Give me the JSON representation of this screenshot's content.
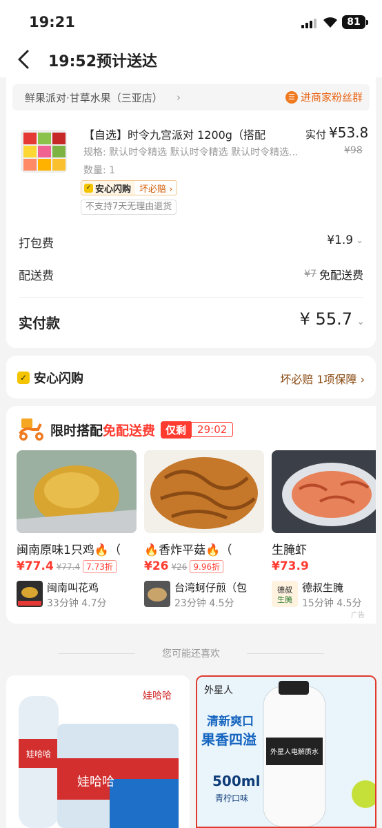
{
  "status_bar": {
    "time": "19:21",
    "battery": "81"
  },
  "nav": {
    "title": "19:52预计送达"
  },
  "order": {
    "shop_name": "鲜果派对·甘草水果（三亚店）",
    "fans_group": "进商家粉丝群",
    "product_name": "【自选】时令九宫派对 1200g（搭配",
    "paid_label": "实付",
    "paid_price": "¥53.8",
    "spec": "规格: 默认时令精选 默认时令精选 默认时令精选...",
    "original_price": "¥98",
    "quantity": "数量: 1",
    "assurance_tag": "安心闪购",
    "assurance_sub": "坏必赔",
    "return_policy": "不支持7天无理由退货",
    "packing_label": "打包费",
    "packing_value": "¥1.9",
    "delivery_label": "配送费",
    "delivery_original": "¥7",
    "delivery_value": "免配送费",
    "total_label": "实付款",
    "total_value": "¥ 55.7"
  },
  "assurance": {
    "title": "安心闪购",
    "detail": "坏必赔 1项保障"
  },
  "deal": {
    "title": "限时搭配",
    "highlight": "免配送费",
    "remain_label": "仅剩",
    "countdown": "29:02",
    "ad_label": "广告",
    "products": [
      {
        "name": "闽南原味1只鸡🔥（",
        "price": "¥77.4",
        "old_price": "¥77.4",
        "discount": "7.73折",
        "shop": "闽南叫花鸡",
        "meta": "33分钟  4.7分"
      },
      {
        "name": "🔥香炸平菇🔥（",
        "price": "¥26",
        "old_price": "¥26",
        "discount": "9.96折",
        "shop": "台湾蚵仔煎（包",
        "meta": "23分钟  4.5分"
      },
      {
        "name": "生腌虾",
        "price": "¥73.9",
        "old_price": "",
        "discount": "",
        "shop": "德叔生腌",
        "meta": "15分钟  4.5分"
      }
    ]
  },
  "recommend": {
    "heading": "您可能还喜欢",
    "item1_brand": "娃哈哈",
    "item2_brand": "外星人",
    "item2_slogan1": "清新爽口",
    "item2_slogan2": "果香四溢",
    "item2_volume": "500ml",
    "item2_flavor": "青柠口味",
    "item2_label": "外星人电解质水"
  },
  "colors": {
    "accent_red": "#ff3b30",
    "accent_orange": "#e86412",
    "assure_yellow": "#f5c400"
  }
}
